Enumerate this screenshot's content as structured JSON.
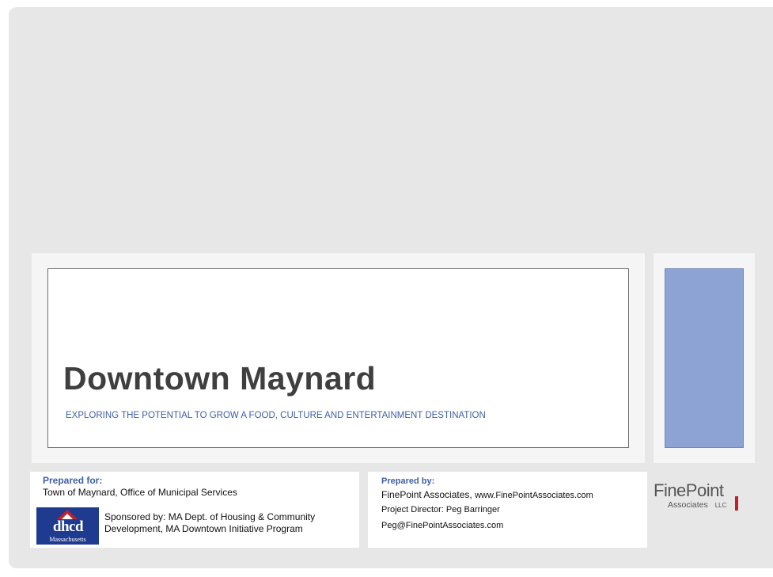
{
  "title": "Downtown Maynard",
  "subtitle": "EXPLORING THE POTENTIAL TO GROW A FOOD, CULTURE AND ENTERTAINMENT DESTINATION",
  "prepared_for": {
    "label": "Prepared for:",
    "text": "Town of Maynard, Office of Municipal Services",
    "sponsor_line1": "Sponsored by: MA Dept. of Housing & Community",
    "sponsor_line2": "Development, MA Downtown Initiative Program",
    "logo_text": "dhcd",
    "logo_subtext": "Massachusetts"
  },
  "prepared_by": {
    "label": "Prepared by:",
    "company": "FinePoint Associates, ",
    "website": "www.FinePointAssociates.com",
    "director": "Project Director: Peg Barringer",
    "email": "Peg@FinePointAssociates.com"
  },
  "finepoint_logo": {
    "name": "FinePoint",
    "sub": "Associates",
    "suffix": "LLC"
  },
  "colors": {
    "background": "#e7e7e7",
    "accent": "#8da3d3",
    "title": "#3f3f3f",
    "subtitle": "#3f5fa5"
  }
}
